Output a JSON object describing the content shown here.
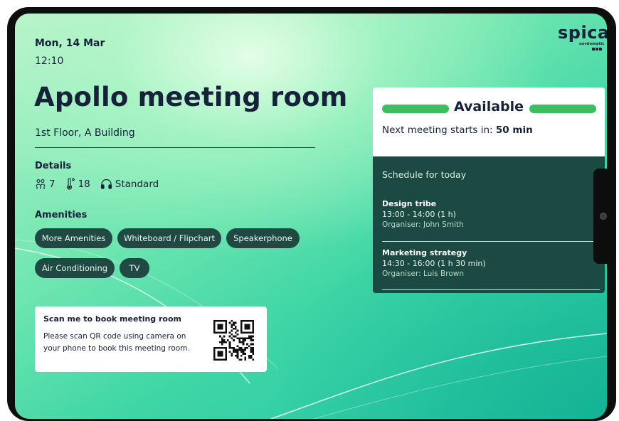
{
  "header": {
    "date": "Mon, 14 Mar",
    "time": "12:10"
  },
  "room": {
    "name": "Apollo meeting room",
    "location": "1st Floor, A Building"
  },
  "details": {
    "label": "Details",
    "capacity": "7",
    "temperature": "18",
    "audio": "Standard",
    "icons": [
      "people-icon",
      "thermometer-icon",
      "headphones-icon"
    ]
  },
  "amenities": {
    "label": "Amenities",
    "items": [
      "More Amenities",
      "Whiteboard / Flipchart",
      "Speakerphone",
      "Air Conditioning",
      "TV"
    ]
  },
  "qr": {
    "title": "Scan me to book meeting room",
    "description": "Please scan QR code using camera on your phone to book this meeting room."
  },
  "brand": {
    "name": "spica",
    "sub": "nordomatic"
  },
  "status": {
    "label": "Available",
    "next_prefix": "Next meeting starts in: ",
    "next_value": "50 min",
    "color": "#3cbf5e"
  },
  "schedule": {
    "title": "Schedule for today",
    "meetings": [
      {
        "name": "Design tribe",
        "time": "13:00 - 14:00 (1 h)",
        "organiser": "Organiser: John Smith"
      },
      {
        "name": "Marketing strategy",
        "time": "14:30 - 16:00 (1 h 30 min)",
        "organiser": "Organiser: Luis Brown"
      }
    ]
  },
  "colors": {
    "text_dark": "#16213a",
    "chip_bg": "#1f4942",
    "schedule_bg": "#1a4a42"
  }
}
